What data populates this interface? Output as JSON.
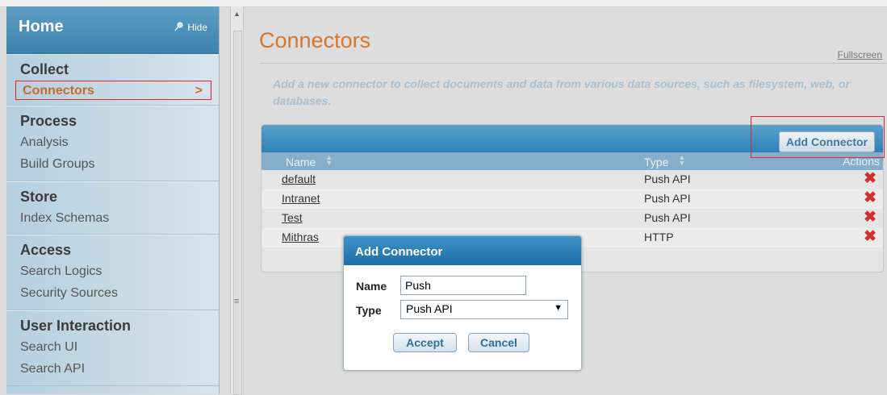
{
  "sidebar": {
    "home_label": "Home",
    "hide_label": "Hide",
    "sections": [
      {
        "title": "Collect",
        "items": [
          "Connectors"
        ],
        "selected": "Connectors"
      },
      {
        "title": "Process",
        "items": [
          "Analysis",
          "Build Groups"
        ]
      },
      {
        "title": "Store",
        "items": [
          "Index Schemas"
        ]
      },
      {
        "title": "Access",
        "items": [
          "Search Logics",
          "Security Sources"
        ]
      },
      {
        "title": "User Interaction",
        "items": [
          "Search UI",
          "Search API"
        ]
      }
    ],
    "selected_chevron": ">"
  },
  "main": {
    "title": "Connectors",
    "fullscreen_label": "Fullscreen",
    "description": "Add a new connector to collect documents and data from various data sources, such as filesystem, web, or databases.",
    "add_button_label": "Add Connector",
    "columns": {
      "name": "Name",
      "type": "Type",
      "actions": "Actions"
    },
    "rows": [
      {
        "name": "default",
        "type": "Push API"
      },
      {
        "name": "Intranet",
        "type": "Push API"
      },
      {
        "name": "Test",
        "type": "Push API"
      },
      {
        "name": "Mithras",
        "type": "HTTP"
      }
    ],
    "delete_glyph": "✖"
  },
  "dialog": {
    "title": "Add Connector",
    "name_label": "Name",
    "name_value": "Push",
    "type_label": "Type",
    "type_value": "Push API",
    "accept_label": "Accept",
    "cancel_label": "Cancel"
  },
  "colors": {
    "accent_orange": "#d5782e",
    "header_blue": "#3d82ae",
    "highlight_red": "#e0262a",
    "delete_red": "#d03030"
  },
  "icons": {
    "hide": "pin-icon",
    "chevron": "chevron-right-icon",
    "sort": "sort-icon",
    "delete": "delete-x-icon",
    "dropdown": "chevron-down-icon"
  }
}
